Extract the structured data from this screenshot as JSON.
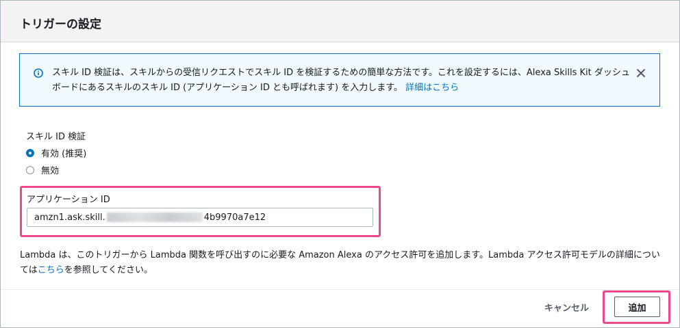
{
  "dialog": {
    "title": "トリガーの設定"
  },
  "info": {
    "text": "スキル ID 検証は、スキルからの受信リクエストでスキル ID を検証するための簡単な方法です。これを設定するには、Alexa Skills Kit ダッシュボードにあるスキルのスキル ID (アプリケーション ID とも呼ばれます) を入力します。",
    "link": "詳細はこちら",
    "icon": "info-icon",
    "close_icon": "close-icon"
  },
  "skill_id_verification": {
    "label": "スキル ID 検証",
    "options": [
      {
        "label": "有効 (推奨)",
        "selected": true
      },
      {
        "label": "無効",
        "selected": false
      }
    ]
  },
  "application_id": {
    "label": "アプリケーション ID",
    "value_prefix": "amzn1.ask.skill.",
    "value_suffix": "4b9970a7e12"
  },
  "note": {
    "text_before": "Lambda は、このトリガーから Lambda 関数を呼び出すのに必要な Amazon Alexa のアクセス許可を追加します。Lambda アクセス許可モデルの詳細については",
    "link": "こちら",
    "text_after": "を参照してください。"
  },
  "footer": {
    "cancel_label": "キャンセル",
    "add_label": "追加"
  },
  "colors": {
    "accent": "#0073bb",
    "highlight": "#f0468c",
    "info_bg": "#f1faff",
    "header_bg": "#f2f3f3"
  }
}
